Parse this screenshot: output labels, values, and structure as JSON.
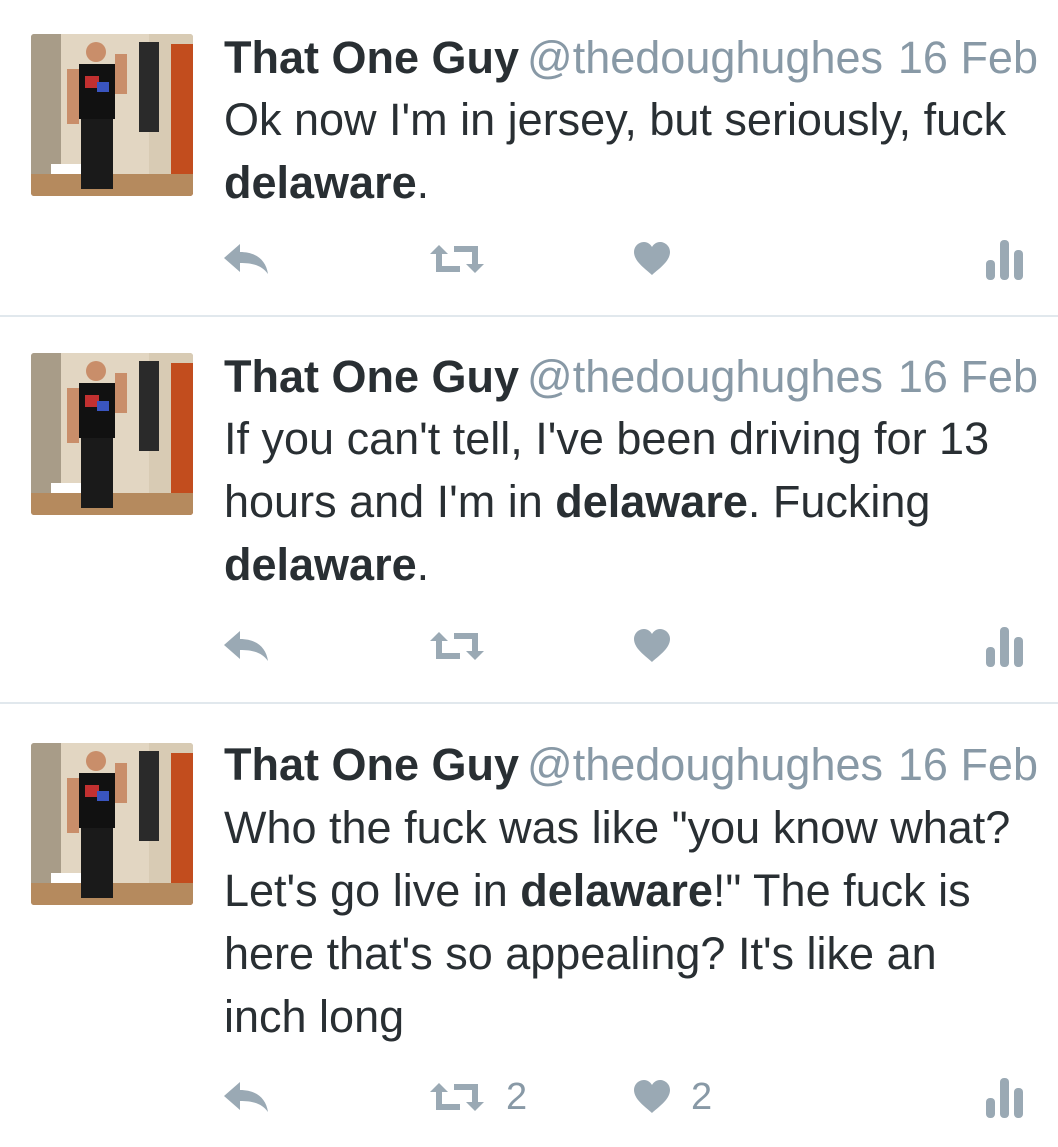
{
  "colors": {
    "text": "#292f33",
    "muted": "#8899a6",
    "icon": "#9aa9b4",
    "divider": "#e1e8ed"
  },
  "tweets": [
    {
      "name": "That One Guy",
      "handle": "@thedoughughes",
      "date": "16 Feb",
      "text": [
        {
          "t": "Ok now I'm in jersey, but seriously, fuck ",
          "b": false
        },
        {
          "t": "delaware",
          "b": true
        },
        {
          "t": ".",
          "b": false
        }
      ],
      "retweets": "",
      "likes": ""
    },
    {
      "name": "That One Guy",
      "handle": "@thedoughughes",
      "date": "16 Feb",
      "text": [
        {
          "t": "If you can't tell, I've been driving for 13 hours and I'm in ",
          "b": false
        },
        {
          "t": "delaware",
          "b": true
        },
        {
          "t": ". Fucking ",
          "b": false
        },
        {
          "t": "delaware",
          "b": true
        },
        {
          "t": ".",
          "b": false
        }
      ],
      "retweets": "",
      "likes": ""
    },
    {
      "name": "That One Guy",
      "handle": "@thedoughughes",
      "date": "16 Feb",
      "text": [
        {
          "t": "Who the fuck was like \"you know what? Let's go live in ",
          "b": false
        },
        {
          "t": "delaware",
          "b": true
        },
        {
          "t": "!\" The fuck is here that's so appealing? It's like an inch long",
          "b": false
        }
      ],
      "retweets": "2",
      "likes": "2"
    }
  ]
}
